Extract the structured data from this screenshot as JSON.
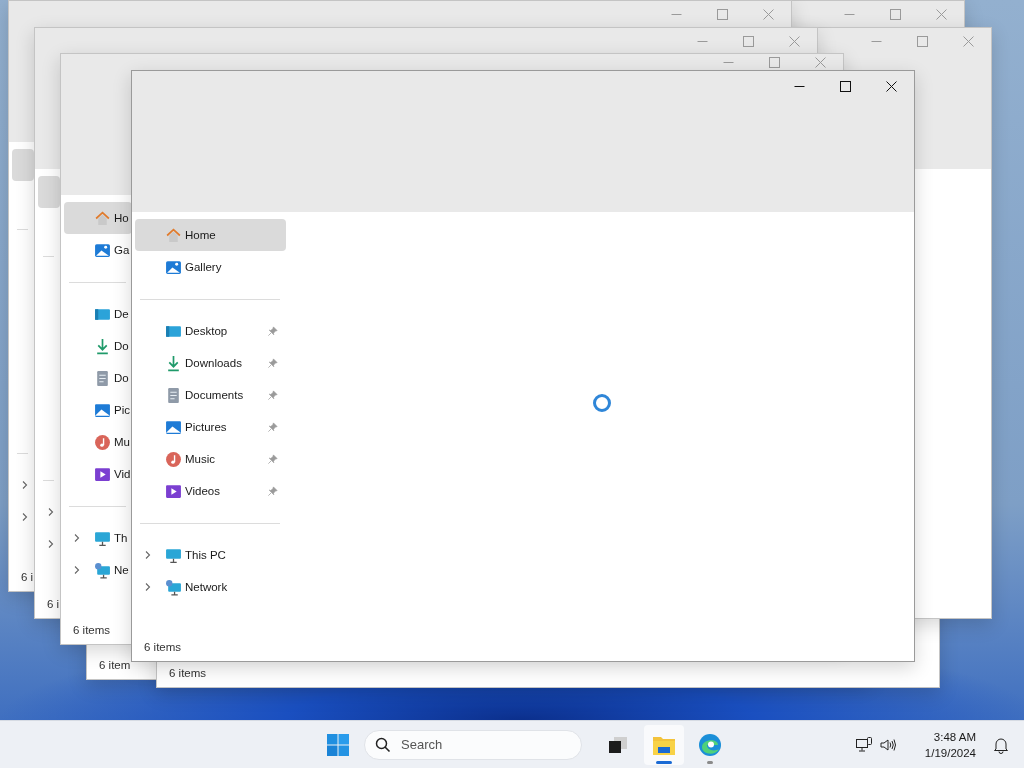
{
  "background_windows": [
    {
      "sidebar": [
        [
          {
            "selected": true
          },
          {
            "selected": false
          }
        ],
        [
          {
            "selected": false
          },
          {
            "selected": false
          },
          {
            "selected": false
          },
          {
            "selected": false
          },
          {
            "selected": false
          },
          {
            "selected": false
          }
        ],
        [
          {
            "selected": false,
            "expandable": true
          },
          {
            "selected": false,
            "expandable": true
          }
        ]
      ],
      "status": "6 i"
    },
    {
      "sidebar": [
        [
          {
            "selected": true
          },
          {
            "selected": false
          }
        ],
        [
          {
            "selected": false
          },
          {
            "selected": false
          },
          {
            "selected": false
          },
          {
            "selected": false
          },
          {
            "selected": false
          },
          {
            "selected": false
          }
        ],
        [
          {
            "selected": false,
            "expandable": true
          },
          {
            "selected": false,
            "expandable": true
          }
        ]
      ],
      "status": "6 i"
    },
    {
      "status": "6 item"
    },
    {
      "status": "6 items"
    },
    {
      "sidebar": [
        [
          {
            "label": "Ho",
            "selected": true
          },
          {
            "label": "Ga",
            "selected": false
          }
        ],
        [
          {
            "label": "De",
            "selected": false
          },
          {
            "label": "Do",
            "selected": false
          },
          {
            "label": "Do",
            "selected": false
          },
          {
            "label": "Pic",
            "selected": false
          },
          {
            "label": "Mu",
            "selected": false
          },
          {
            "label": "Vid",
            "selected": false
          }
        ],
        [
          {
            "label": "Th",
            "selected": false,
            "expandable": true
          },
          {
            "label": "Ne",
            "selected": false,
            "expandable": true
          }
        ]
      ],
      "status": "6 items"
    }
  ],
  "front_window": {
    "loading": true,
    "sidebar": [
      [
        {
          "label": "Home",
          "selected": true
        },
        {
          "label": "Gallery",
          "selected": false
        }
      ],
      [
        {
          "label": "Desktop",
          "selected": false,
          "pinned": true
        },
        {
          "label": "Downloads",
          "selected": false,
          "pinned": true
        },
        {
          "label": "Documents",
          "selected": false,
          "pinned": true
        },
        {
          "label": "Pictures",
          "selected": false,
          "pinned": true
        },
        {
          "label": "Music",
          "selected": false,
          "pinned": true
        },
        {
          "label": "Videos",
          "selected": false,
          "pinned": true
        }
      ],
      [
        {
          "label": "This PC",
          "selected": false,
          "expandable": true
        },
        {
          "label": "Network",
          "selected": false,
          "expandable": true
        }
      ]
    ],
    "status": "6 items"
  },
  "taskbar": {
    "search": {
      "placeholder": "Search"
    },
    "apps": [
      {
        "selected": false,
        "running": false
      },
      {
        "selected": true,
        "running": true
      },
      {
        "selected": false,
        "running": true
      }
    ],
    "clock": {
      "time": "3:48 AM",
      "date": "1/19/2024"
    }
  }
}
